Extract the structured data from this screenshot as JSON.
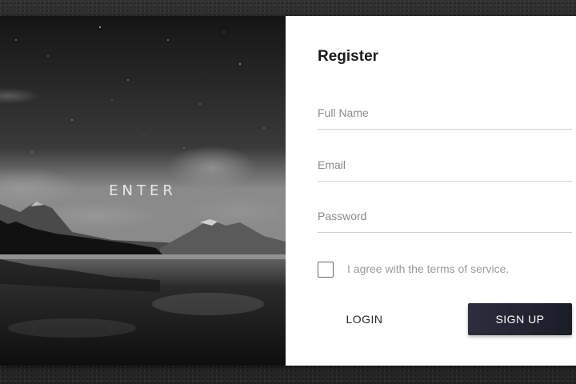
{
  "hero": {
    "label": "ENTER"
  },
  "register": {
    "title": "Register",
    "full_name_placeholder": "Full Name",
    "email_placeholder": "Email",
    "password_placeholder": "Password",
    "terms_label": "I agree with the terms of service.",
    "login_label": "LOGIN",
    "signup_label": "SIGN UP"
  },
  "colors": {
    "signup_button": "#252633",
    "panel_background": "#ffffff",
    "page_background": "#2b2b2b"
  }
}
